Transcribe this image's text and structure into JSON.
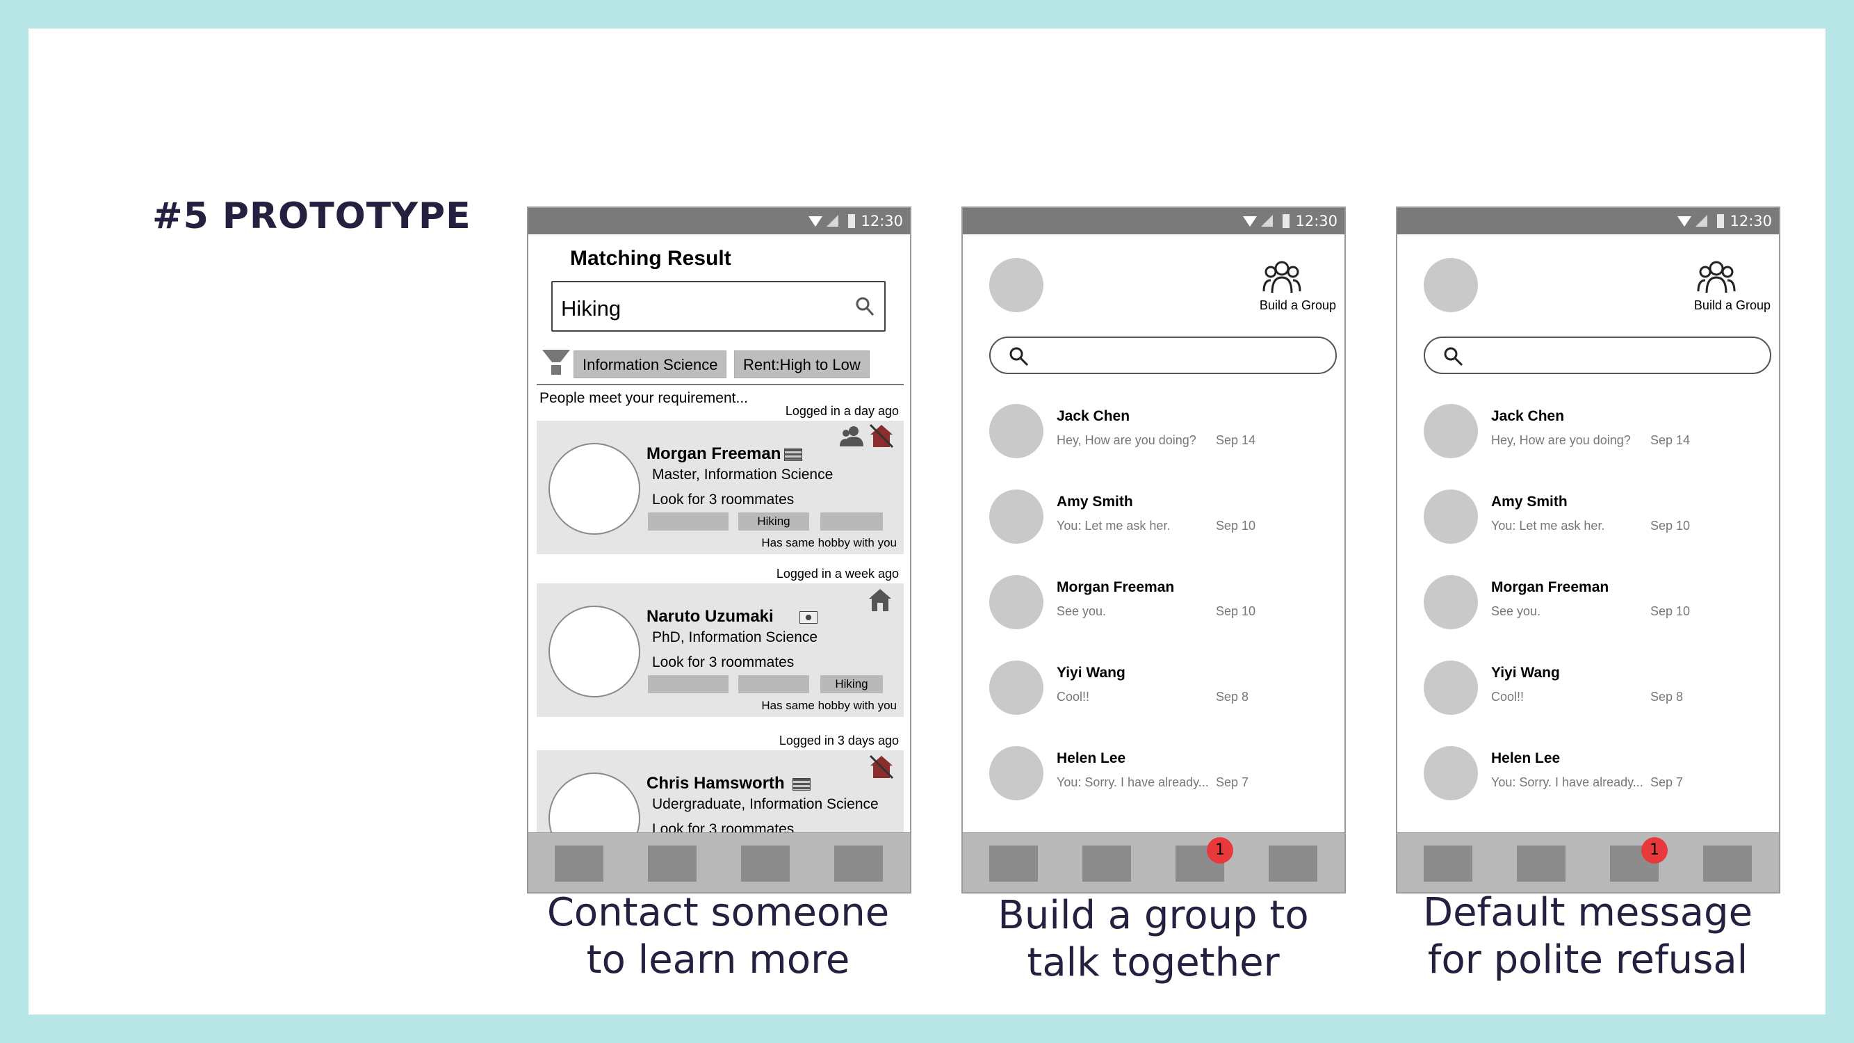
{
  "slide": {
    "title": "#5 PROTOTYPE"
  },
  "status": {
    "time": "12:30"
  },
  "phone1": {
    "title": "Matching Result",
    "search_value": "Hiking",
    "chips": [
      "Information Science",
      "Rent:High to Low"
    ],
    "subtitle": "People meet your requirement...",
    "cards": [
      {
        "logged": "Logged in a day ago",
        "name": "Morgan Freeman",
        "degree": "Master, Information Science",
        "look": "Look for 3 roommates",
        "tags": [
          "",
          "Hiking",
          ""
        ],
        "hobby": "Has same hobby with you"
      },
      {
        "logged": "Logged in a week ago",
        "name": "Naruto Uzumaki",
        "degree": "PhD, Information Science",
        "look": "Look for 3 roommates",
        "tags": [
          "",
          "",
          "Hiking"
        ],
        "hobby": "Has same hobby with you"
      },
      {
        "logged": "Logged in 3 days ago",
        "name": "Chris Hamsworth",
        "degree": "Udergraduate, Information Science",
        "look": "Look for 3 roommates"
      }
    ]
  },
  "chat": {
    "build_group_label": "Build a Group",
    "badge": "1",
    "rows": [
      {
        "name": "Jack Chen",
        "message": "Hey, How are you doing?",
        "date": "Sep 14"
      },
      {
        "name": "Amy Smith",
        "message": "You: Let me ask her.",
        "date": "Sep 10"
      },
      {
        "name": "Morgan Freeman",
        "message": "See you.",
        "date": "Sep 10"
      },
      {
        "name": "Yiyi Wang",
        "message": "Cool!!",
        "date": "Sep 8"
      },
      {
        "name": "Helen Lee",
        "message": "You: Sorry. I have already...",
        "date": "Sep 7"
      }
    ]
  },
  "captions": {
    "c1": [
      "Contact someone",
      "to learn more"
    ],
    "c2": [
      "Build a group to",
      "talk together"
    ],
    "c3": [
      "Default message",
      "for polite refusal"
    ]
  }
}
